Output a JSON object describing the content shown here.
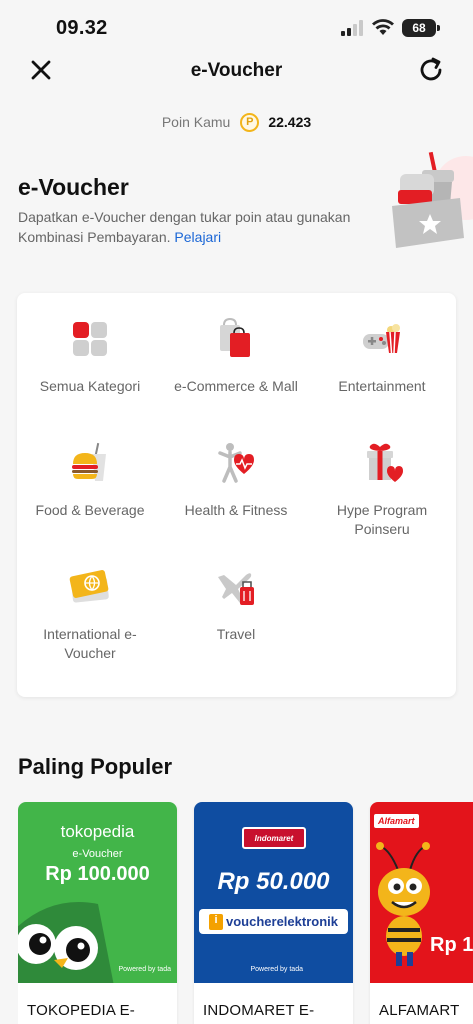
{
  "status_bar": {
    "time": "09.32",
    "battery": "68"
  },
  "nav": {
    "title": "e-Voucher",
    "close_icon": "close-icon",
    "refresh_icon": "refresh-icon"
  },
  "points": {
    "label": "Poin Kamu",
    "coin_symbol": "P",
    "value": "22.423"
  },
  "hero": {
    "title": "e-Voucher",
    "description": "Dapatkan e-Voucher dengan tukar poin atau gunakan Kombinasi Pembayaran.",
    "link": "Pelajari"
  },
  "categories": [
    {
      "label": "Semua Kategori",
      "icon": "all-categories-icon"
    },
    {
      "label": "e-Commerce & Mall",
      "icon": "shopping-bags-icon"
    },
    {
      "label": "Entertainment",
      "icon": "gamepad-popcorn-icon"
    },
    {
      "label": "Food & Beverage",
      "icon": "burger-drink-icon"
    },
    {
      "label": "Health & Fitness",
      "icon": "fitness-heart-icon"
    },
    {
      "label": "Hype Program Poinseru",
      "icon": "gift-heart-icon"
    },
    {
      "label": "International e-Voucher",
      "icon": "globe-ticket-icon"
    },
    {
      "label": "Travel",
      "icon": "plane-luggage-icon"
    }
  ],
  "popular": {
    "title": "Paling Populer",
    "vouchers": [
      {
        "name": "TOKOPEDIA E-",
        "brand": "tokopedia",
        "label": "e-Voucher",
        "amount": "Rp 100.000",
        "powered": "Powered by tada",
        "color": "#42b549"
      },
      {
        "name": "INDOMARET E-",
        "brand": "Indomaret",
        "amount": "Rp 50.000",
        "tag_i": "i",
        "tag_text": "voucherelektronik",
        "powered": "Powered by tada",
        "color": "#0f4da1"
      },
      {
        "name": "ALFAMART",
        "brand": "Alfamart",
        "amount": "Rp 1(",
        "color": "#e3141b"
      }
    ]
  },
  "colors": {
    "accent_red": "#e31e24",
    "link_blue": "#1a66d6",
    "coin_gold": "#f3b51a"
  }
}
